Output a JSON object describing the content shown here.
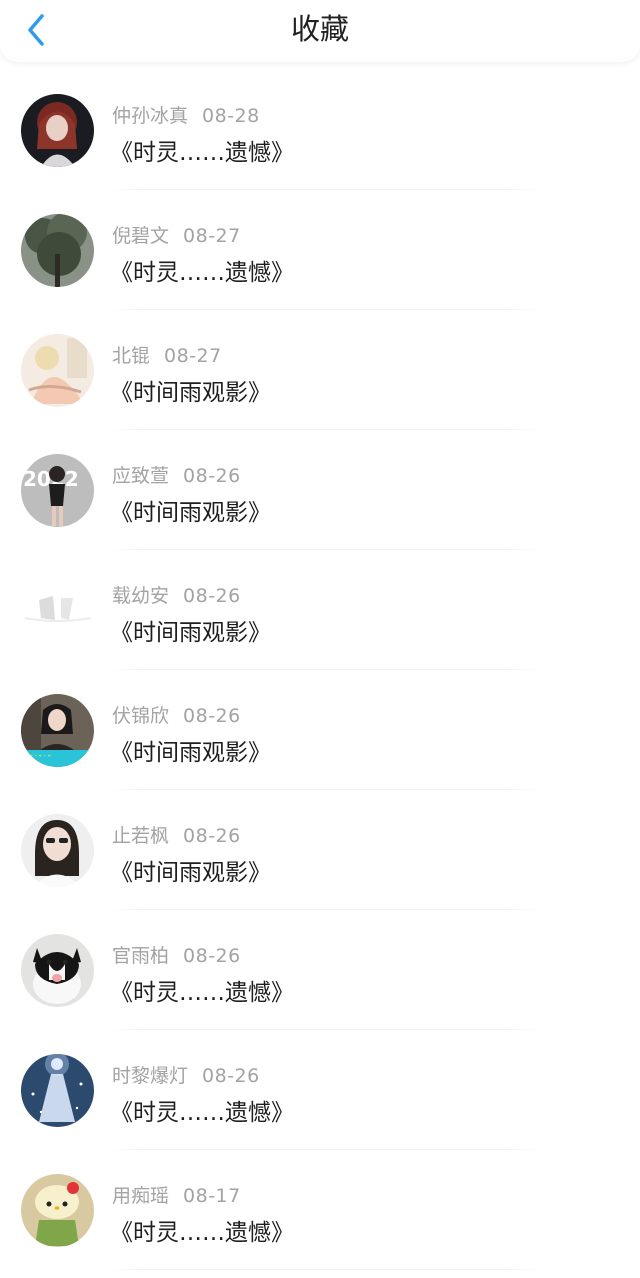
{
  "header": {
    "title": "收藏",
    "back_icon": "chevron-left-icon",
    "accent_color": "#2f9bf0"
  },
  "items": [
    {
      "name": "仲孙冰真",
      "date": "08-28",
      "title": "《时灵……遗憾》",
      "avatar": "anime-girl-red-hair"
    },
    {
      "name": "倪碧文",
      "date": "08-27",
      "title": "《时灵……遗憾》",
      "avatar": "tree-photo"
    },
    {
      "name": "北锟",
      "date": "08-27",
      "title": "《时间雨观影》",
      "avatar": "illustration-girl"
    },
    {
      "name": "应致萱",
      "date": "08-26",
      "title": "《时间雨观影》",
      "avatar": "girl-2022"
    },
    {
      "name": "载幼安",
      "date": "08-26",
      "title": "《时间雨观影》",
      "avatar": "faded-photo"
    },
    {
      "name": "伏锦欣",
      "date": "08-26",
      "title": "《时间雨观影》",
      "avatar": "girl-photo-cyan"
    },
    {
      "name": "止若枫",
      "date": "08-26",
      "title": "《时间雨观影》",
      "avatar": "woman-sunglasses"
    },
    {
      "name": "官雨柏",
      "date": "08-26",
      "title": "《时灵……遗憾》",
      "avatar": "husky-puppy"
    },
    {
      "name": "时黎爆灯",
      "date": "08-26",
      "title": "《时灵……遗憾》",
      "avatar": "glowing-angel"
    },
    {
      "name": "用痴瑶",
      "date": "08-17",
      "title": "《时灵……遗憾》",
      "avatar": "hello-kitty-toy"
    }
  ]
}
